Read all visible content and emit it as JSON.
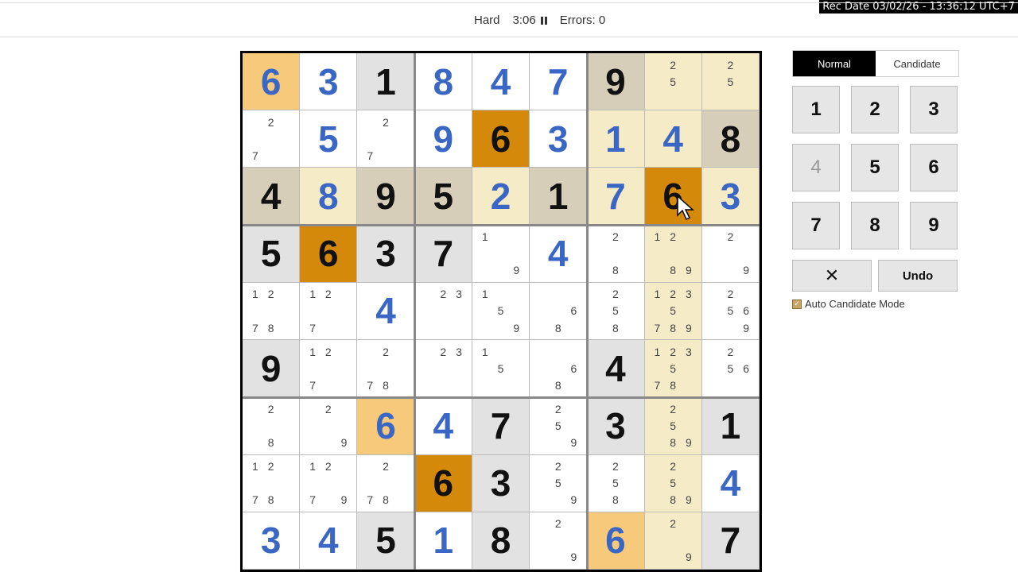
{
  "recording": "Rec Date  03/02/26 - 13:36:12  UTC+7",
  "header": {
    "difficulty": "Hard",
    "time": "3:06",
    "errors": "Errors: 0"
  },
  "colors": {
    "selected": "#d4890a",
    "same_value": "#f7c97a",
    "peer": "#f6ebc7",
    "given_bg": "#e2e2e2",
    "given_peer": "#d7ceb9",
    "user_digit": "#3a66c4"
  },
  "grid": [
    [
      {
        "v": "6",
        "u": 1,
        "bg": "same_value"
      },
      {
        "v": "3",
        "u": 1
      },
      {
        "v": "1",
        "bg": "given_bg"
      },
      {
        "v": "8",
        "u": 1
      },
      {
        "v": "4",
        "u": 1
      },
      {
        "v": "7",
        "u": 1
      },
      {
        "v": "9",
        "bg": "given_peer"
      },
      {
        "c": "2 5",
        "bg": "peer"
      },
      {
        "c": "2 5",
        "bg": "peer"
      }
    ],
    [
      {
        "c": "2 7"
      },
      {
        "v": "5",
        "u": 1
      },
      {
        "c": "2 7"
      },
      {
        "v": "9",
        "u": 1
      },
      {
        "v": "6",
        "bg": "selected"
      },
      {
        "v": "3",
        "u": 1
      },
      {
        "v": "1",
        "u": 1,
        "bg": "peer"
      },
      {
        "v": "4",
        "u": 1,
        "bg": "peer"
      },
      {
        "v": "8",
        "bg": "given_peer"
      }
    ],
    [
      {
        "v": "4",
        "bg": "given_peer"
      },
      {
        "v": "8",
        "u": 1,
        "bg": "peer"
      },
      {
        "v": "9",
        "bg": "given_peer"
      },
      {
        "v": "5",
        "bg": "given_peer"
      },
      {
        "v": "2",
        "u": 1,
        "bg": "peer"
      },
      {
        "v": "1",
        "bg": "given_peer"
      },
      {
        "v": "7",
        "u": 1,
        "bg": "peer"
      },
      {
        "v": "6",
        "bg": "selected"
      },
      {
        "v": "3",
        "u": 1,
        "bg": "peer"
      }
    ],
    [
      {
        "v": "5",
        "bg": "given_bg"
      },
      {
        "v": "6",
        "bg": "selected"
      },
      {
        "v": "3",
        "bg": "given_bg"
      },
      {
        "v": "7",
        "bg": "given_bg"
      },
      {
        "c": "1 9"
      },
      {
        "v": "4",
        "u": 1
      },
      {
        "c": "2 8"
      },
      {
        "c": "1 2 8 9",
        "bg": "peer"
      },
      {
        "c": "2 9"
      }
    ],
    [
      {
        "c": "1 2 7 8"
      },
      {
        "c": "1 2 7"
      },
      {
        "v": "4",
        "u": 1
      },
      {
        "c": "2 3"
      },
      {
        "c": "1 5 9"
      },
      {
        "c": "6 8"
      },
      {
        "c": "2 5 8"
      },
      {
        "c": "1 2 3 5 7 8 9",
        "bg": "peer"
      },
      {
        "c": "2 5 6 9"
      }
    ],
    [
      {
        "v": "9",
        "bg": "given_bg"
      },
      {
        "c": "1 2 7"
      },
      {
        "c": "2 7 8"
      },
      {
        "c": "2 3"
      },
      {
        "c": "1 5"
      },
      {
        "c": "6 8"
      },
      {
        "v": "4",
        "bg": "given_bg"
      },
      {
        "c": "1 2 3 5 7 8",
        "bg": "peer"
      },
      {
        "c": "2 5 6"
      }
    ],
    [
      {
        "c": "2 8"
      },
      {
        "c": "2 9"
      },
      {
        "v": "6",
        "u": 1,
        "bg": "same_value"
      },
      {
        "v": "4",
        "u": 1
      },
      {
        "v": "7",
        "bg": "given_bg"
      },
      {
        "c": "2 5 9"
      },
      {
        "v": "3",
        "bg": "given_bg"
      },
      {
        "c": "2 5 8 9",
        "bg": "peer"
      },
      {
        "v": "1",
        "bg": "given_bg"
      }
    ],
    [
      {
        "c": "1 2 7 8"
      },
      {
        "c": "1 2 7 9"
      },
      {
        "c": "2 7 8"
      },
      {
        "v": "6",
        "bg": "selected"
      },
      {
        "v": "3",
        "bg": "given_bg"
      },
      {
        "c": "2 5 9"
      },
      {
        "c": "2 5 8"
      },
      {
        "c": "2 5 8 9",
        "bg": "peer"
      },
      {
        "v": "4",
        "u": 1
      }
    ],
    [
      {
        "v": "3",
        "u": 1
      },
      {
        "v": "4",
        "u": 1
      },
      {
        "v": "5",
        "bg": "given_bg"
      },
      {
        "v": "1",
        "u": 1
      },
      {
        "v": "8",
        "bg": "given_bg"
      },
      {
        "c": "2 9"
      },
      {
        "v": "6",
        "u": 1,
        "bg": "same_value"
      },
      {
        "c": "2 9",
        "bg": "peer"
      },
      {
        "v": "7",
        "bg": "given_bg"
      }
    ]
  ],
  "panel": {
    "mode_normal": "Normal",
    "mode_candidate": "Candidate",
    "keys": [
      "1",
      "2",
      "3",
      "4",
      "5",
      "6",
      "7",
      "8",
      "9"
    ],
    "dim_keys": [
      "4"
    ],
    "erase_symbol": "✕",
    "undo": "Undo",
    "auto_candidate_label": "Auto Candidate Mode",
    "auto_candidate_checked": true
  }
}
